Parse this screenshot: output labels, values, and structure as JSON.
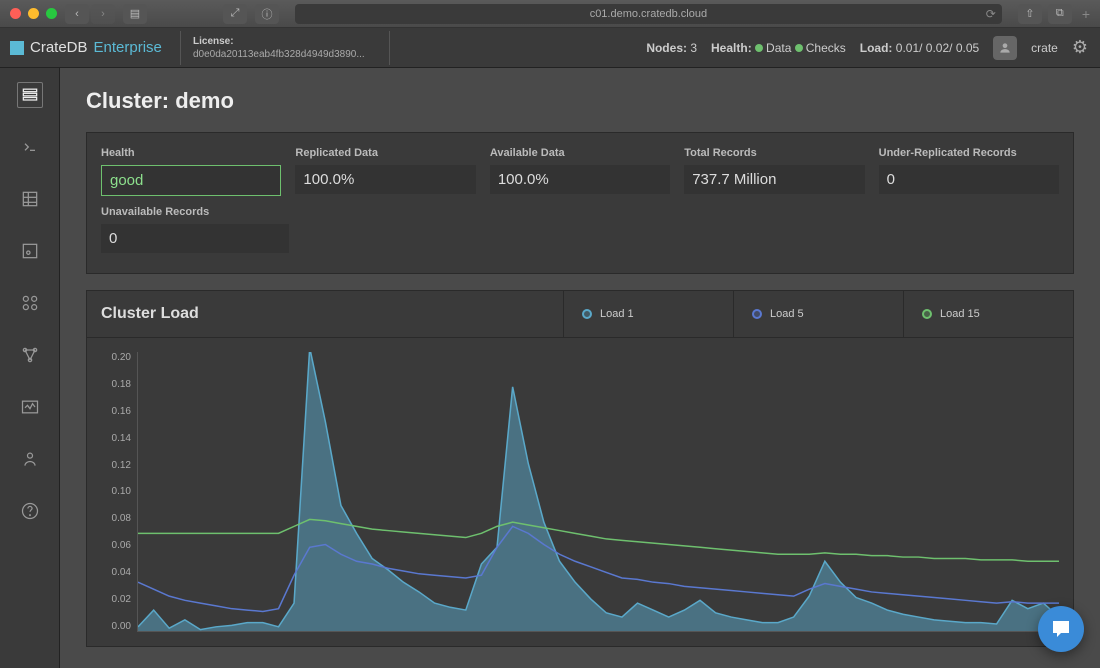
{
  "browser": {
    "url": "c01.demo.cratedb.cloud"
  },
  "brand": {
    "main": "CrateDB",
    "sub": "Enterprise"
  },
  "license": {
    "label": "License:",
    "value": "d0e0da20113eab4fb328d4949d3890..."
  },
  "status": {
    "nodes_label": "Nodes:",
    "nodes": "3",
    "health_label": "Health:",
    "data": "Data",
    "checks": "Checks",
    "load_label": "Load:",
    "load": "0.01/ 0.02/ 0.05",
    "user": "crate"
  },
  "page_title": "Cluster: demo",
  "stats": {
    "row1": [
      {
        "label": "Health",
        "value": "good",
        "good": true
      },
      {
        "label": "Replicated Data",
        "value": "100.0%"
      },
      {
        "label": "Available Data",
        "value": "100.0%"
      },
      {
        "label": "Total Records",
        "value": "737.7 Million"
      },
      {
        "label": "Under-Replicated Records",
        "value": "0"
      }
    ],
    "row2": [
      {
        "label": "Unavailable Records",
        "value": "0"
      }
    ]
  },
  "chart": {
    "title": "Cluster Load",
    "legend": {
      "l1": "Load 1",
      "l5": "Load 5",
      "l15": "Load 15"
    }
  },
  "chart_data": {
    "type": "area",
    "ylabel": "",
    "ylim": [
      0,
      0.2
    ],
    "yticks": [
      0.0,
      0.02,
      0.04,
      0.06,
      0.08,
      0.1,
      0.12,
      0.14,
      0.16,
      0.18,
      0.2
    ],
    "x": [
      0,
      1,
      2,
      3,
      4,
      5,
      6,
      7,
      8,
      9,
      10,
      11,
      12,
      13,
      14,
      15,
      16,
      17,
      18,
      19,
      20,
      21,
      22,
      23,
      24,
      25,
      26,
      27,
      28,
      29,
      30,
      31,
      32,
      33,
      34,
      35,
      36,
      37,
      38,
      39,
      40,
      41,
      42,
      43,
      44,
      45,
      46,
      47,
      48,
      49,
      50,
      51,
      52,
      53,
      54,
      55,
      56,
      57,
      58,
      59
    ],
    "series": [
      {
        "name": "Load 1",
        "color": "#5aa8c9",
        "fill": true,
        "values": [
          0.003,
          0.015,
          0.002,
          0.008,
          0.001,
          0.003,
          0.004,
          0.006,
          0.006,
          0.003,
          0.02,
          0.203,
          0.15,
          0.09,
          0.07,
          0.052,
          0.044,
          0.035,
          0.028,
          0.02,
          0.017,
          0.015,
          0.048,
          0.06,
          0.175,
          0.12,
          0.078,
          0.05,
          0.035,
          0.023,
          0.013,
          0.01,
          0.02,
          0.015,
          0.01,
          0.015,
          0.022,
          0.013,
          0.01,
          0.008,
          0.006,
          0.006,
          0.01,
          0.025,
          0.05,
          0.035,
          0.024,
          0.02,
          0.015,
          0.012,
          0.01,
          0.008,
          0.007,
          0.006,
          0.006,
          0.005,
          0.022,
          0.016,
          0.02,
          0.01
        ]
      },
      {
        "name": "Load 5",
        "color": "#5a78d0",
        "fill": false,
        "values": [
          0.035,
          0.03,
          0.025,
          0.022,
          0.02,
          0.018,
          0.016,
          0.015,
          0.014,
          0.016,
          0.04,
          0.06,
          0.062,
          0.055,
          0.05,
          0.048,
          0.045,
          0.043,
          0.041,
          0.04,
          0.039,
          0.038,
          0.04,
          0.06,
          0.075,
          0.07,
          0.062,
          0.055,
          0.05,
          0.046,
          0.042,
          0.038,
          0.037,
          0.035,
          0.034,
          0.032,
          0.031,
          0.03,
          0.029,
          0.028,
          0.027,
          0.026,
          0.025,
          0.03,
          0.034,
          0.032,
          0.03,
          0.028,
          0.027,
          0.026,
          0.025,
          0.024,
          0.023,
          0.022,
          0.021,
          0.02,
          0.021,
          0.02,
          0.02,
          0.02
        ]
      },
      {
        "name": "Load 15",
        "color": "#6ec06e",
        "fill": false,
        "values": [
          0.07,
          0.07,
          0.07,
          0.07,
          0.07,
          0.07,
          0.07,
          0.07,
          0.07,
          0.07,
          0.075,
          0.08,
          0.079,
          0.077,
          0.075,
          0.073,
          0.072,
          0.071,
          0.07,
          0.069,
          0.068,
          0.067,
          0.07,
          0.075,
          0.078,
          0.076,
          0.074,
          0.072,
          0.07,
          0.068,
          0.066,
          0.065,
          0.064,
          0.063,
          0.062,
          0.061,
          0.06,
          0.059,
          0.058,
          0.057,
          0.056,
          0.055,
          0.055,
          0.055,
          0.056,
          0.055,
          0.055,
          0.054,
          0.054,
          0.053,
          0.053,
          0.052,
          0.052,
          0.052,
          0.051,
          0.051,
          0.051,
          0.05,
          0.05,
          0.05
        ]
      }
    ]
  }
}
